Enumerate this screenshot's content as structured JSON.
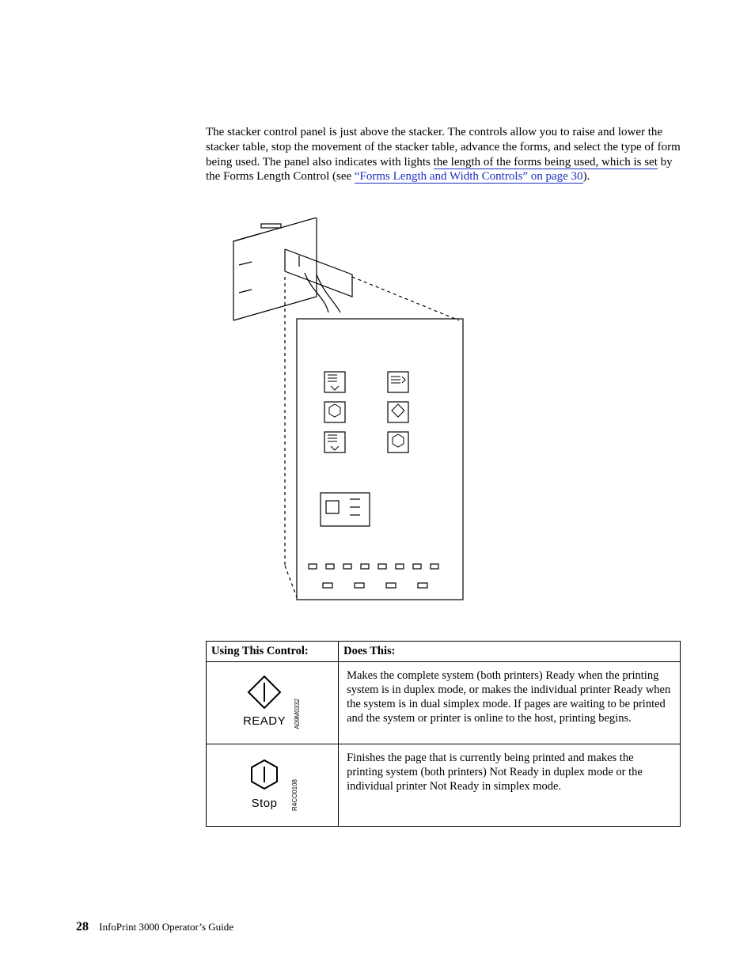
{
  "paragraph": {
    "lead": "The stacker control panel is just above the stacker. The controls allow you to raise and lower the stacker table, stop the movement of the stacker table, advance the forms, and select the type of form being used. The panel also indicates with lights ",
    "underlined_lead": "the length of the forms being used, which is set",
    "mid": " by the Forms Length Control (see ",
    "link_text": "“Forms Length and Width Controls” on page 30",
    "tail": ")."
  },
  "table": {
    "col1": "Using This Control:",
    "col2": "Does This:",
    "rows": [
      {
        "icon": "ready",
        "label": "READY",
        "partno": "A09M0332",
        "desc": "Makes the complete system (both printers) Ready when the printing system is in duplex mode, or makes the individual printer Ready when the system is in dual simplex mode. If pages are waiting to be printed and the system or printer is online to the host, printing begins."
      },
      {
        "icon": "stop",
        "label": "Stop",
        "partno": "R4CO0108",
        "desc": "Finishes the page that is currently being printed and makes the printing system (both printers) Not Ready in duplex mode or the individual printer Not Ready in simplex mode."
      }
    ]
  },
  "footer": {
    "page_no": "28",
    "title": "InfoPrint 3000 Operator’s Guide"
  }
}
